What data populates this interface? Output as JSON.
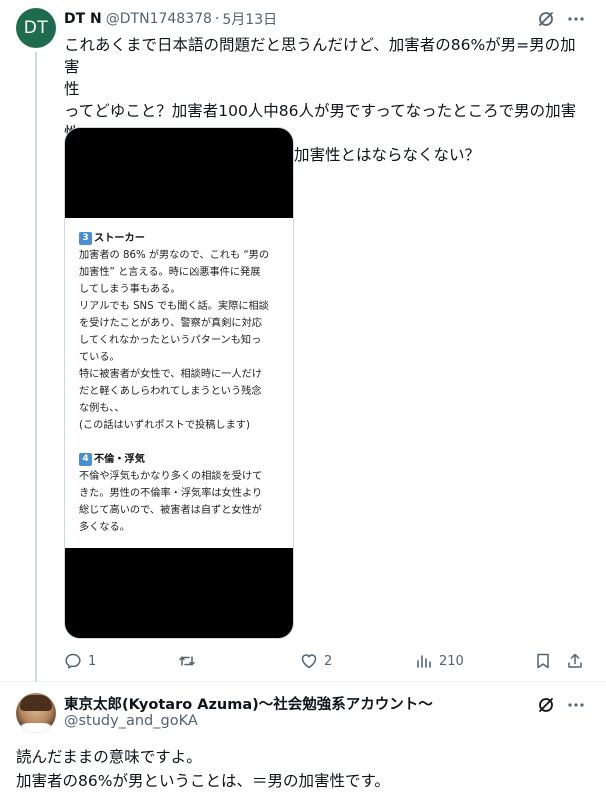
{
  "tweet1": {
    "avatar_text": "DT",
    "author_name": "DT N",
    "handle": "@DTN1748378",
    "separator": "·",
    "date": "5月13日",
    "text_lines": [
      "これあくまで日本語の問題だと思うんだけど、加害者の86%が男=男の加害",
      "性",
      "ってどゆこと？加害者100人中86人が男ですってなったところで男の加害性",
      "の高さの話をするならともかく=加害性とはならなくない？"
    ],
    "media_image": {
      "section3_num": "3",
      "section3_title": "ストーカー",
      "section3_lines": [
        "加害者の 86% が男なので、これも “男の",
        "加害性” と言える。時に凶悪事件に発展",
        "してしまう事もある。",
        "リアルでも SNS でも聞く話。実際に相談",
        "を受けたことがあり、警察が真剣に対応",
        "してくれなかったというパターンも知っ",
        "ている。",
        "特に被害者が女性で、相談時に一人だけ",
        "だと軽くあしらわれてしまうという残念",
        "な例も、、",
        "(この話はいずれポストで投稿します)"
      ],
      "section4_num": "4",
      "section4_title": "不倫・浮気",
      "section4_lines": [
        "不倫や浮気もかなり多くの相談を受けて",
        "きた。男性の不倫率・浮気率は女性より",
        "総じて高いので、被害者は自ずと女性が",
        "多くなる。"
      ]
    },
    "actions": {
      "reply_count": "1",
      "retweet_count": "",
      "like_count": "2",
      "view_count": "210"
    }
  },
  "tweet2": {
    "author_name": "東京太郎(Kyotaro Azuma)〜社会勉強系アカウント〜",
    "handle": "@study_and_goKA",
    "text_lines": [
      "読んだままの意味ですよ。",
      "加害者の86%が男ということは、＝男の加害性です。"
    ]
  },
  "colors": {
    "text": "#0f1419",
    "secondary": "#536471",
    "avatar_bg": "#1e6b4f",
    "border": "#cfd9de"
  }
}
